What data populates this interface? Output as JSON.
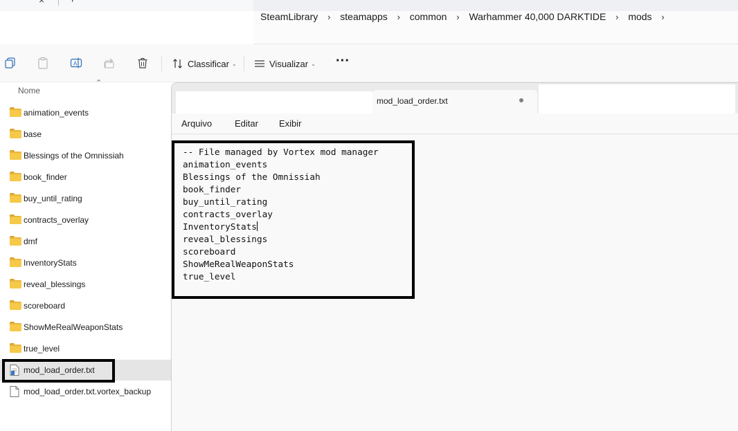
{
  "breadcrumbs": [
    "SteamLibrary",
    "steamapps",
    "common",
    "Warhammer 40,000 DARKTIDE",
    "mods"
  ],
  "toolbar": {
    "sort_label": "Classificar",
    "view_label": "Visualizar",
    "more_label": "···"
  },
  "file_list": {
    "column_header": "Nome",
    "items": [
      {
        "name": "animation_events",
        "type": "folder"
      },
      {
        "name": "base",
        "type": "folder"
      },
      {
        "name": "Blessings of the Omnissiah",
        "type": "folder"
      },
      {
        "name": "book_finder",
        "type": "folder"
      },
      {
        "name": "buy_until_rating",
        "type": "folder"
      },
      {
        "name": "contracts_overlay",
        "type": "folder"
      },
      {
        "name": "dmf",
        "type": "folder"
      },
      {
        "name": "InventoryStats",
        "type": "folder"
      },
      {
        "name": "reveal_blessings",
        "type": "folder"
      },
      {
        "name": "scoreboard",
        "type": "folder"
      },
      {
        "name": "ShowMeRealWeaponStats",
        "type": "folder"
      },
      {
        "name": "true_level",
        "type": "folder"
      },
      {
        "name": "mod_load_order.txt",
        "type": "text-file",
        "selected": true
      },
      {
        "name": "mod_load_order.txt.vortex_backup",
        "type": "file"
      }
    ]
  },
  "notepad": {
    "tab_title": "mod_load_order.txt",
    "menu": [
      "Arquivo",
      "Editar",
      "Exibir"
    ],
    "lines": [
      "-- File managed by Vortex mod manager",
      "animation_events",
      "Blessings of the Omnissiah",
      "book_finder",
      "buy_until_rating",
      "contracts_overlay",
      "InventoryStats",
      "reveal_blessings",
      "scoreboard",
      "ShowMeRealWeaponStats",
      "true_level"
    ]
  }
}
